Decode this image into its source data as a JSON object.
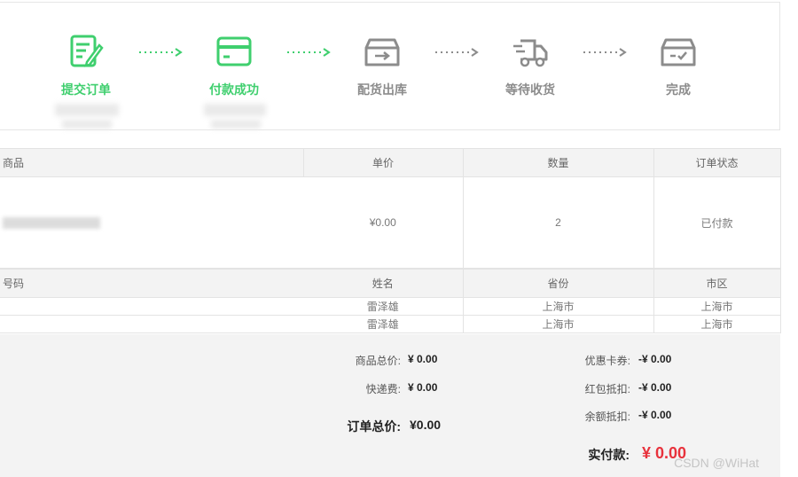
{
  "steps": [
    {
      "label": "提交订单",
      "icon": "edit-document-icon",
      "status": "done"
    },
    {
      "label": "付款成功",
      "icon": "credit-card-icon",
      "status": "done"
    },
    {
      "label": "配货出库",
      "icon": "outbox-icon",
      "status": "pending"
    },
    {
      "label": "等待收货",
      "icon": "truck-icon",
      "status": "pending"
    },
    {
      "label": "完成",
      "icon": "inbox-check-icon",
      "status": "pending"
    }
  ],
  "colors": {
    "active": "#3fcf6e",
    "inactive": "#8c8c8c",
    "link": "#37a9d6",
    "price_red": "#e8323c"
  },
  "goods_table": {
    "headers": [
      "商品",
      "单价",
      "数量",
      "订单状态"
    ],
    "rows": [
      {
        "unit_price": "¥0.00",
        "quantity": "2",
        "status": "已付款"
      }
    ]
  },
  "address_table": {
    "headers": [
      "号码",
      "姓名",
      "省份",
      "市区"
    ],
    "rows": [
      {
        "phone": "",
        "name": "雷泽雄",
        "province": "上海市",
        "city": "上海市"
      },
      {
        "phone": "",
        "name": "雷泽雄",
        "province": "上海市",
        "city": "上海市"
      }
    ]
  },
  "summary": {
    "goods_total_label": "商品总价:",
    "goods_total_value": "¥ 0.00",
    "shipping_label": "快递费:",
    "shipping_value": "¥ 0.00",
    "order_total_label": "订单总价:",
    "order_total_value": "¥0.00",
    "coupon_label": "优惠卡券:",
    "coupon_value": "-¥ 0.00",
    "redpacket_label": "红包抵扣:",
    "redpacket_value": "-¥ 0.00",
    "balance_label": "余额抵扣:",
    "balance_value": "-¥ 0.00",
    "paid_label": "实付款:",
    "paid_value": "¥ 0.00"
  },
  "watermark": "CSDN @WiHat"
}
